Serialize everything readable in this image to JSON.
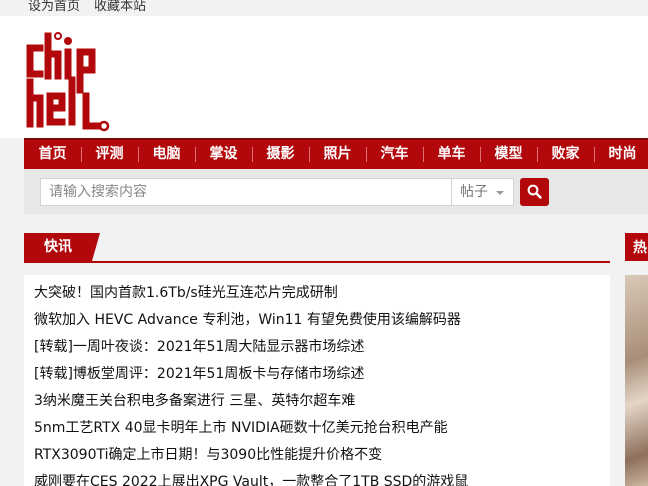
{
  "topbar": {
    "set_home": "设为首页",
    "bookmark": "收藏本站"
  },
  "brand": {
    "logo_text": "chiphell",
    "color": "#b3080b"
  },
  "nav": {
    "items": [
      "首页",
      "评测",
      "电脑",
      "掌设",
      "摄影",
      "照片",
      "汽车",
      "单车",
      "模型",
      "败家",
      "时尚"
    ]
  },
  "search": {
    "placeholder": "请输入搜索内容",
    "scope": "帖子",
    "button_icon": "search-icon"
  },
  "kuaixun": {
    "title": "快讯",
    "items": [
      "大突破！国内首款1.6Tb/s硅光互连芯片完成研制",
      "微软加入 HEVC Advance 专利池，Win11 有望免费使用该编解码器",
      "[转载]一周叶夜谈：2021年51周大陆显示器市场综述",
      "[转载]博板堂周评：2021年51周板卡与存储市场综述",
      "3纳米魔王关台积电多备案进行 三星、英特尔超车难",
      "5nm工艺RTX 40显卡明年上市 NVIDIA砸数十亿美元抢台积电产能",
      "RTX3090Ti确定上市日期！与3090比性能提升价格不变",
      "威刚要在CES 2022上展出XPG Vault，一款整合了1TB SSD的游戏鼠"
    ]
  },
  "side": {
    "tab_label": "热"
  }
}
